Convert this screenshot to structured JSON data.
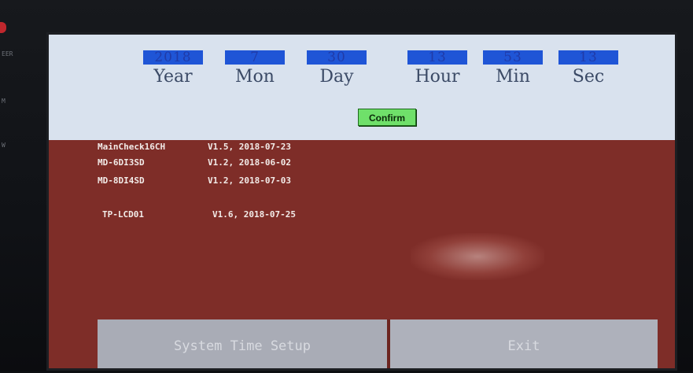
{
  "bezel": {
    "labels": [
      "EER",
      "M",
      "W"
    ]
  },
  "time_setup": {
    "fields": [
      {
        "label": "Year",
        "value": "2018"
      },
      {
        "label": "Mon",
        "value": "7"
      },
      {
        "label": "Day",
        "value": "30"
      },
      {
        "label": "Hour",
        "value": "13"
      },
      {
        "label": "Min",
        "value": "53"
      },
      {
        "label": "Sec",
        "value": "13"
      }
    ],
    "confirm_label": "Confirm"
  },
  "versions": [
    {
      "module": "MainCheck16CH",
      "version": "V1.5, 2018-07-23"
    },
    {
      "module": "MD-6DI3SD",
      "version": "V1.2, 2018-06-02"
    },
    {
      "module": "MD-8DI4SD",
      "version": "V1.2, 2018-07-03"
    },
    {
      "module": "TP-LCD01",
      "version": "V1.6, 2018-07-25"
    }
  ],
  "buttons": {
    "system_time_setup": "System Time Setup",
    "exit": "Exit"
  },
  "colors": {
    "screen_background": "#7e2d28",
    "panel_background": "#d9e2ee",
    "value_box": "#1f55d6",
    "confirm_button": "#6fe06a",
    "bottom_buttons": "#a9acb6"
  }
}
